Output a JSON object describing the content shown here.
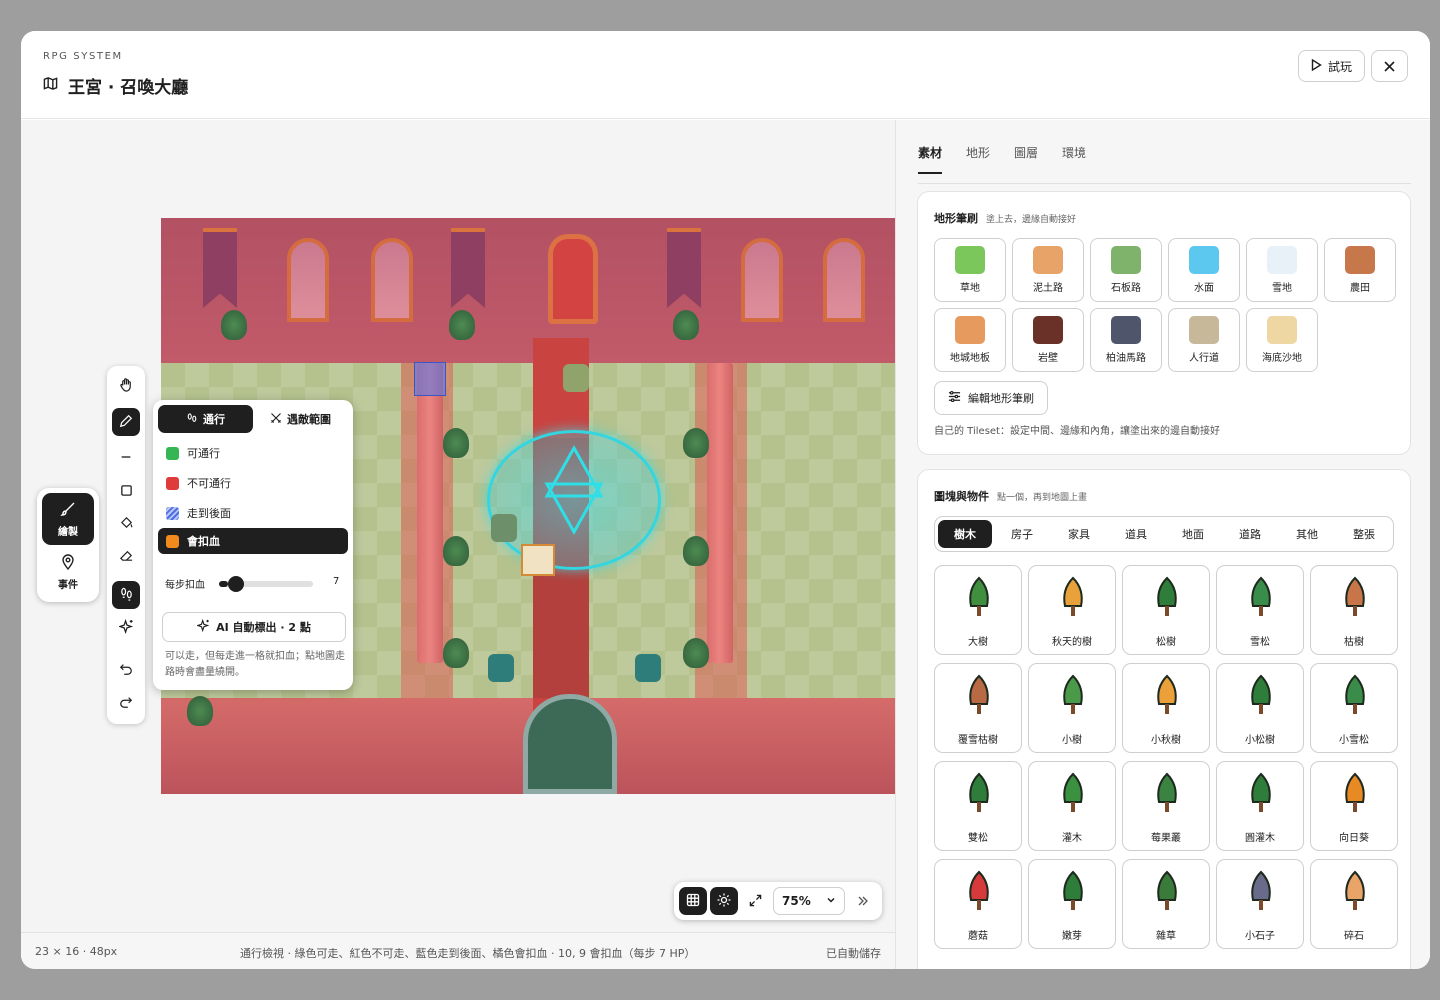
{
  "header": {
    "system_label": "RPG SYSTEM",
    "title": "王宮 · 召喚大廳",
    "play_label": "試玩"
  },
  "mode_panel": {
    "draw_label": "繪製",
    "event_label": "事件"
  },
  "popover": {
    "tabs": [
      {
        "label": "通行",
        "active": true
      },
      {
        "label": "遇敵範圍",
        "active": false
      }
    ],
    "legend": [
      {
        "label": "可通行",
        "color": "#35b553"
      },
      {
        "label": "不可通行",
        "color": "#e03b3b"
      },
      {
        "label": "走到後面",
        "color": "#4f6fe0"
      },
      {
        "label": "會扣血",
        "color": "#f28a1e",
        "active": true
      }
    ],
    "slider_label": "每步扣血",
    "slider_value": "7",
    "slider_fraction": 0.1,
    "ai_label": "AI 自動標出 · 2 點",
    "note": "可以走，但每走進一格就扣血；點地圖走路時會盡量繞開。"
  },
  "toolbar": {
    "zoom": "75%"
  },
  "statusbar": {
    "size": "23 × 16 · 48px",
    "message": "通行檢視 · 綠色可走、紅色不可走、藍色走到後面、橘色會扣血 · 10, 9 會扣血（每步 7 HP）",
    "saved": "已自動儲存"
  },
  "right_tabs": [
    {
      "label": "素材",
      "active": true
    },
    {
      "label": "地形",
      "active": false
    },
    {
      "label": "圖層",
      "active": false
    },
    {
      "label": "環境",
      "active": false
    }
  ],
  "terrain": {
    "title": "地形筆刷",
    "subtitle": "塗上去，邊緣自動接好",
    "brushes": [
      {
        "label": "草地",
        "color": "#7bc75c"
      },
      {
        "label": "泥土路",
        "color": "#e8a468"
      },
      {
        "label": "石板路",
        "color": "#7fb36c"
      },
      {
        "label": "水面",
        "color": "#5cc8ef"
      },
      {
        "label": "雪地",
        "color": "#e8f1f7"
      },
      {
        "label": "農田",
        "color": "#c7784a"
      },
      {
        "label": "地城地板",
        "color": "#e79a5e"
      },
      {
        "label": "岩壁",
        "color": "#6a3129"
      },
      {
        "label": "柏油馬路",
        "color": "#4f556b"
      },
      {
        "label": "人行道",
        "color": "#c7b89a"
      },
      {
        "label": "海底沙地",
        "color": "#efd7a3"
      }
    ],
    "edit_label": "編輯地形筆刷",
    "note": "自己的 Tileset：設定中間、邊緣和內角，讓塗出來的邊自動接好"
  },
  "objects": {
    "title": "圖塊與物件",
    "subtitle": "點一個，再到地圖上畫",
    "categories": [
      {
        "label": "樹木",
        "active": true
      },
      {
        "label": "房子",
        "active": false
      },
      {
        "label": "家具",
        "active": false
      },
      {
        "label": "道具",
        "active": false
      },
      {
        "label": "地面",
        "active": false
      },
      {
        "label": "道路",
        "active": false
      },
      {
        "label": "其他",
        "active": false
      },
      {
        "label": "整張",
        "active": false
      }
    ],
    "items": [
      {
        "label": "大樹",
        "color": "#3f8f3f"
      },
      {
        "label": "秋天的樹",
        "color": "#e9a23b"
      },
      {
        "label": "松樹",
        "color": "#2f7d3a"
      },
      {
        "label": "雪松",
        "color": "#3a8c4a"
      },
      {
        "label": "枯樹",
        "color": "#c8754a"
      },
      {
        "label": "覆雪枯樹",
        "color": "#b86a45"
      },
      {
        "label": "小樹",
        "color": "#4a9a4a"
      },
      {
        "label": "小秋樹",
        "color": "#eba03a"
      },
      {
        "label": "小松樹",
        "color": "#2f7d3a"
      },
      {
        "label": "小雪松",
        "color": "#3a8c4a"
      },
      {
        "label": "雙松",
        "color": "#2f7d3a"
      },
      {
        "label": "灌木",
        "color": "#3a9140"
      },
      {
        "label": "莓果叢",
        "color": "#3a8340"
      },
      {
        "label": "圓灌木",
        "color": "#2f7d3a"
      },
      {
        "label": "向日葵",
        "color": "#e88a24"
      },
      {
        "label": "蘑菇",
        "color": "#d63a3a"
      },
      {
        "label": "嫩芽",
        "color": "#2f7d3a"
      },
      {
        "label": "雜草",
        "color": "#3a7a3a"
      },
      {
        "label": "小石子",
        "color": "#6a6a8a"
      },
      {
        "label": "碎石",
        "color": "#e9a468"
      }
    ]
  }
}
